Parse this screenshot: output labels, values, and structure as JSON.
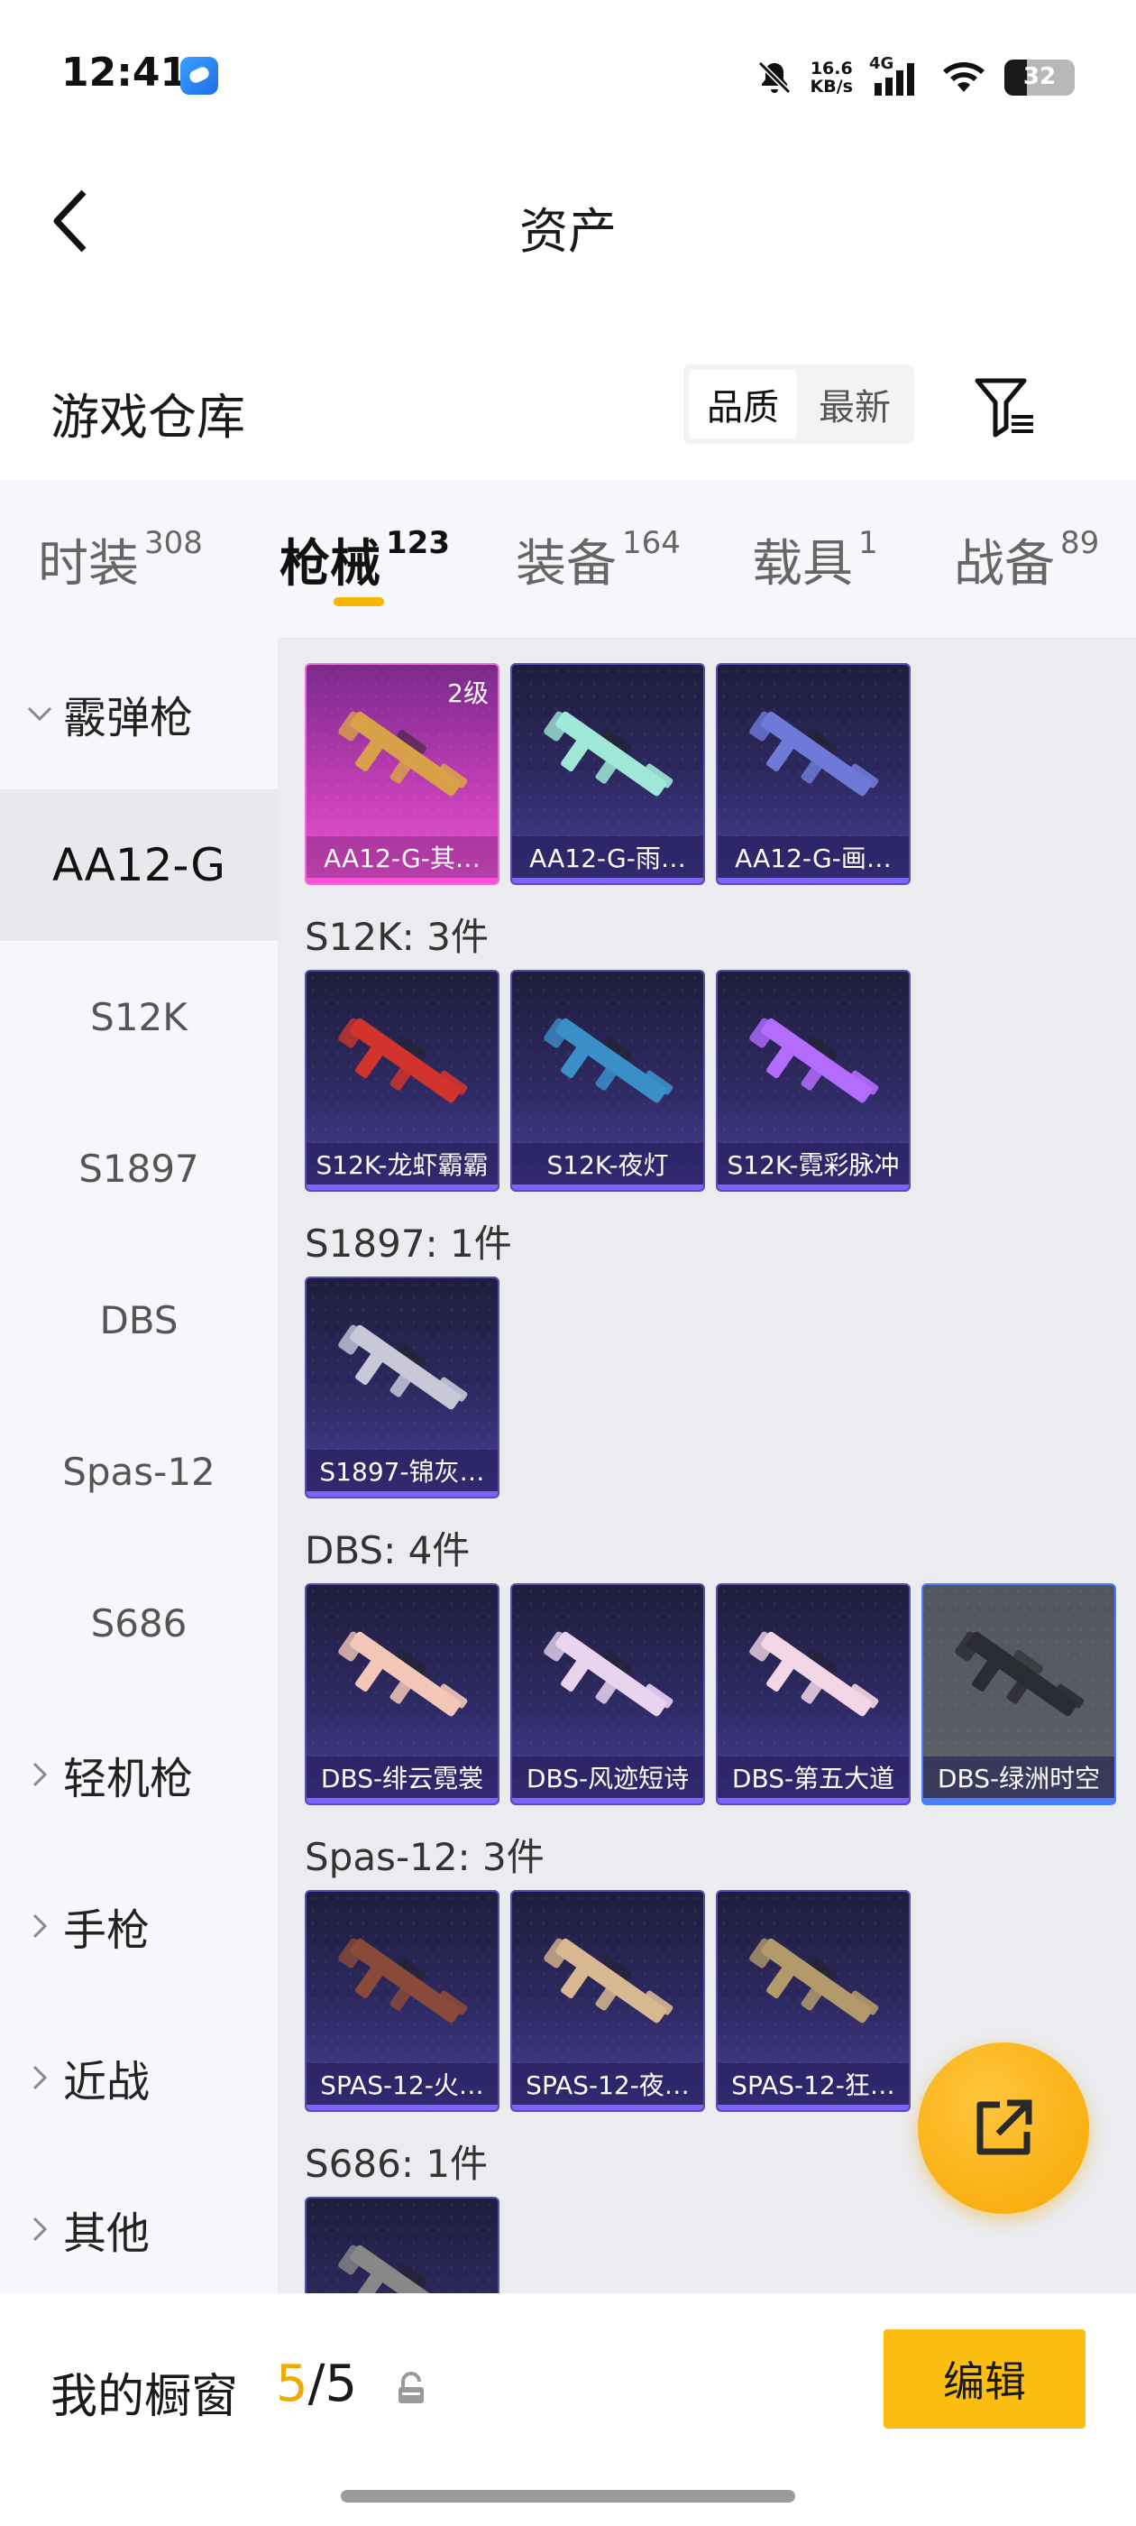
{
  "status": {
    "time": "12:41",
    "speed_value": "16.6",
    "speed_unit": "KB/s",
    "network": "4G",
    "battery": "32"
  },
  "header": {
    "title": "资产"
  },
  "section": {
    "title": "游戏仓库",
    "sort_options": [
      "品质",
      "最新"
    ],
    "active_sort": "品质"
  },
  "tabs": [
    {
      "label": "时装",
      "count": "308"
    },
    {
      "label": "枪械",
      "count": "123",
      "active": true
    },
    {
      "label": "装备",
      "count": "164"
    },
    {
      "label": "载具",
      "count": "1"
    },
    {
      "label": "战备",
      "count": "89"
    }
  ],
  "sidebar": {
    "categories": [
      {
        "label": "霰弹枪",
        "expanded": true
      },
      {
        "label": "轻机枪"
      },
      {
        "label": "手枪"
      },
      {
        "label": "近战"
      },
      {
        "label": "其他"
      }
    ],
    "subitems": [
      "AA12-G",
      "S12K",
      "S1897",
      "DBS",
      "Spas-12",
      "S686"
    ],
    "active_subitem": "AA12-G"
  },
  "groups": [
    {
      "title": "",
      "items": [
        {
          "name": "AA12-G-其…",
          "style": "pink",
          "badge": "2级",
          "color": "#d9a04a"
        },
        {
          "name": "AA12-G-雨…",
          "style": "purple",
          "color": "#9fe8d8"
        },
        {
          "name": "AA12-G-画…",
          "style": "purple",
          "color": "#6f7ad8"
        }
      ]
    },
    {
      "title": "S12K: 3件",
      "items": [
        {
          "name": "S12K-龙虾霸霸",
          "style": "purple",
          "color": "#d0342c"
        },
        {
          "name": "S12K-夜灯",
          "style": "purple",
          "color": "#3b8fc8"
        },
        {
          "name": "S12K-霓彩脉冲",
          "style": "purple",
          "color": "#b46cff"
        }
      ]
    },
    {
      "title": "S1897: 1件",
      "items": [
        {
          "name": "S1897-锦灰…",
          "style": "purple",
          "color": "#c8c8d8"
        }
      ]
    },
    {
      "title": "DBS: 4件",
      "items": [
        {
          "name": "DBS-绯云霓裳",
          "style": "purple",
          "color": "#f2c7b8"
        },
        {
          "name": "DBS-风迹短诗",
          "style": "purple",
          "color": "#e8d4ef"
        },
        {
          "name": "DBS-第五大道",
          "style": "purple",
          "color": "#f3d6e6"
        },
        {
          "name": "DBS-绿洲时空",
          "style": "gray",
          "color": "#2a2c33"
        }
      ]
    },
    {
      "title": "Spas-12: 3件",
      "items": [
        {
          "name": "SPAS-12-火…",
          "style": "purple",
          "color": "#8a4a3a"
        },
        {
          "name": "SPAS-12-夜…",
          "style": "purple",
          "color": "#d8b890"
        },
        {
          "name": "SPAS-12-狂…",
          "style": "purple",
          "color": "#b39a6a"
        }
      ]
    },
    {
      "title": "S686: 1件",
      "items": [
        {
          "name": "",
          "style": "purple",
          "color": "#888888"
        }
      ]
    }
  ],
  "bottom": {
    "showcase_label": "我的橱窗",
    "showcase_used": "5",
    "showcase_sep": "/",
    "showcase_total": "5",
    "edit_label": "编辑"
  },
  "colors": {
    "accent": "#f7b500",
    "edit_button": "#fbbd0f",
    "sidebar_bg": "#f5f7fb",
    "content_bg": "#eaecf0"
  },
  "icons": [
    "back-arrow-icon",
    "bell-muted-icon",
    "signal-icon",
    "wifi-icon",
    "battery-icon",
    "filter-icon",
    "chevron-down-icon",
    "chevron-right-icon",
    "share-external-icon",
    "lock-icon"
  ]
}
